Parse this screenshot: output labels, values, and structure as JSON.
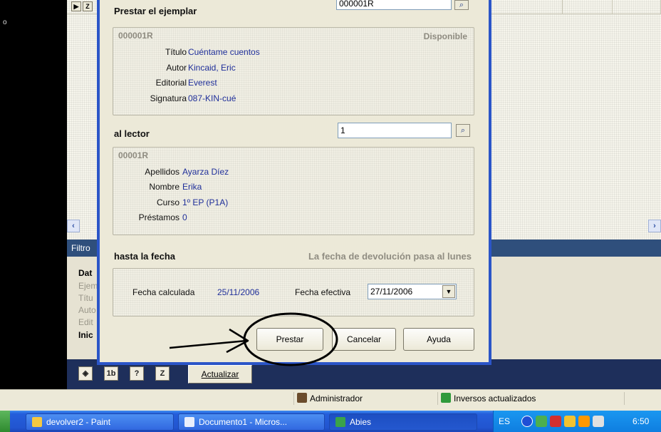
{
  "background_app": {
    "filter_label": "Filtro",
    "filter_items": [
      {
        "text": "Dat",
        "style": "bold"
      },
      {
        "text": "Ejem",
        "style": "dim"
      },
      {
        "text": "Títu",
        "style": "dim"
      },
      {
        "text": "Auto",
        "style": "dim"
      },
      {
        "text": "Edit",
        "style": "dim"
      },
      {
        "text": "Inic",
        "style": "bold"
      }
    ],
    "toolbar_icons": [
      "books-icon",
      "1b-icon",
      "question-icon",
      "z-icon"
    ],
    "toolbar_icon_glyphs": [
      "◈",
      "1b",
      "?",
      "Z"
    ],
    "refresh_label": "Actualizar"
  },
  "dialog": {
    "top_lookup_value": "000001R",
    "loan_section_title": "Prestar el ejemplar",
    "copy": {
      "code": "000001R",
      "status": "Disponible",
      "rows": [
        {
          "label": "Título",
          "value": "Cuéntame cuentos"
        },
        {
          "label": "Autor",
          "value": "Kincaid, Eric"
        },
        {
          "label": "Editorial",
          "value": "Everest"
        },
        {
          "label": "Signatura",
          "value": "087-KIN-cué"
        }
      ]
    },
    "reader_section_title": "al lector",
    "reader_lookup_value": "1",
    "reader": {
      "code": "00001R",
      "rows": [
        {
          "label": "Apellidos",
          "value": "Ayarza Díez"
        },
        {
          "label": "Nombre",
          "value": "Erika"
        },
        {
          "label": "Curso",
          "value": "1º EP (P1A)"
        },
        {
          "label": "Préstamos",
          "value": "0"
        }
      ]
    },
    "date_section_title": "hasta la fecha",
    "date_note": "La fecha de devolución pasa al lunes",
    "calculated_label": "Fecha calculada",
    "calculated_value": "25/11/2006",
    "effective_label": "Fecha efectiva",
    "effective_value": "27/11/2006",
    "buttons": {
      "lend": "Prestar",
      "cancel": "Cancelar",
      "help": "Ayuda"
    }
  },
  "statusbar": {
    "user": "Administrador",
    "status_msg": "Inversos actualizados"
  },
  "taskbar": {
    "items": [
      "devolver2 - Paint",
      "Documento1 - Micros...",
      "Abies"
    ],
    "lang": "ES",
    "clock": "6:50"
  },
  "colors": {
    "dialog_border": "#2b55c8",
    "value_text": "#1f2f9a",
    "filter_bar": "#2f4f7c",
    "taskbar": "#245edb"
  }
}
